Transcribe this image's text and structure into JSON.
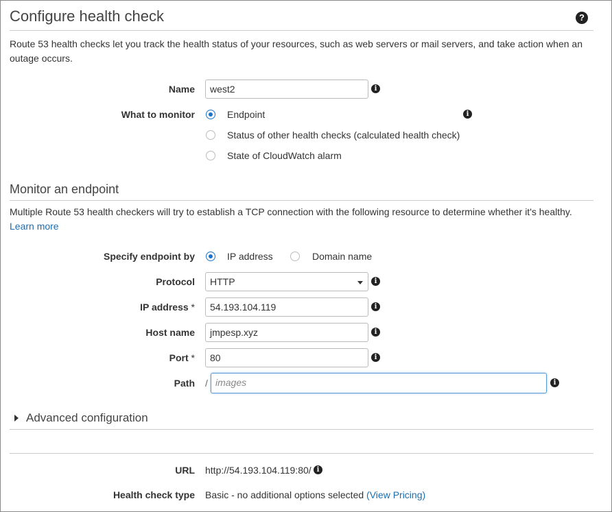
{
  "header": {
    "title": "Configure health check",
    "help_icon": "?"
  },
  "intro": "Route 53 health checks let you track the health status of your resources, such as web servers or mail servers, and take action when an outage occurs.",
  "form": {
    "name_label": "Name",
    "name_value": "west2",
    "monitor_label": "What to monitor",
    "monitor_options": [
      {
        "label": "Endpoint",
        "selected": true
      },
      {
        "label": "Status of other health checks (calculated health check)",
        "selected": false
      },
      {
        "label": "State of CloudWatch alarm",
        "selected": false
      }
    ]
  },
  "endpoint_section": {
    "title": "Monitor an endpoint",
    "description": "Multiple Route 53 health checkers will try to establish a TCP connection with the following resource to determine whether it's healthy.",
    "learn_more": "Learn more",
    "specify_label": "Specify endpoint by",
    "specify_options": [
      {
        "label": "IP address",
        "selected": true
      },
      {
        "label": "Domain name",
        "selected": false
      }
    ],
    "protocol_label": "Protocol",
    "protocol_value": "HTTP",
    "ip_label": "IP address",
    "ip_required": "*",
    "ip_value": "54.193.104.119",
    "host_label": "Host name",
    "host_value": "jmpesp.xyz",
    "port_label": "Port",
    "port_required": "*",
    "port_value": "80",
    "path_label": "Path",
    "path_prefix": "/",
    "path_placeholder": "images"
  },
  "advanced": {
    "label": "Advanced configuration"
  },
  "summary": {
    "url_label": "URL",
    "url_value": "http://54.193.104.119:80/",
    "type_label": "Health check type",
    "type_value": "Basic - no additional options selected",
    "pricing_link": "(View Pricing)"
  },
  "colors": {
    "accent": "#1a73c8",
    "link": "#1a6db3",
    "border": "#cccccc"
  }
}
